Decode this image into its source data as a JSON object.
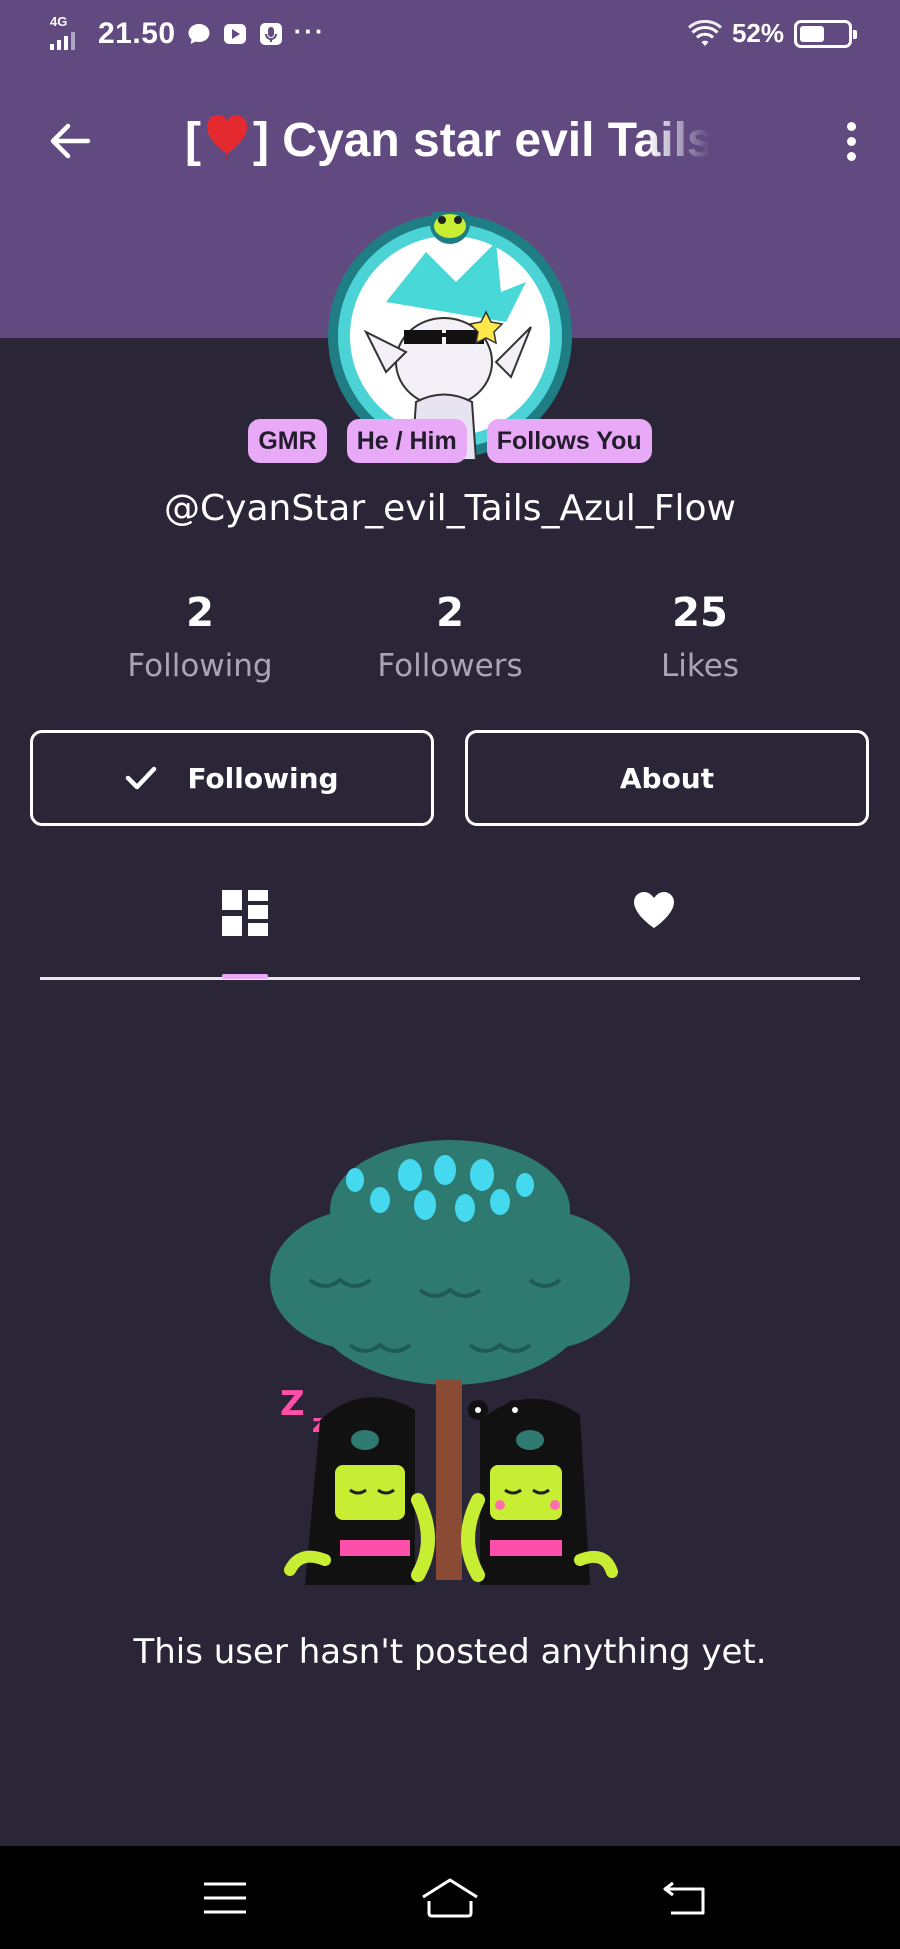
{
  "status_bar": {
    "network": "4G",
    "time": "21.50",
    "more": "···",
    "battery": "52%",
    "battery_level": 0.52
  },
  "appbar": {
    "title_prefix": "[",
    "title_suffix": "] Cyan star evil Tails",
    "back_icon": "arrow-left-icon",
    "more_icon": "more-vertical-icon"
  },
  "profile": {
    "badges": [
      "GMR",
      "He / Him",
      "Follows You"
    ],
    "username": "@CyanStar_evil_Tails_Azul_Flow",
    "stats": [
      {
        "value": "2",
        "label": "Following"
      },
      {
        "value": "2",
        "label": "Followers"
      },
      {
        "value": "25",
        "label": "Likes"
      }
    ],
    "following_button": "Following",
    "about_button": "About"
  },
  "tabs": [
    {
      "name": "posts",
      "icon": "grid-icon",
      "active": true
    },
    {
      "name": "likes",
      "icon": "heart-icon",
      "active": false
    }
  ],
  "empty_state": {
    "message": "This user hasn't posted anything yet."
  },
  "colors": {
    "header": "#614a80",
    "background": "#2a2637",
    "badge": "#e8a9f7",
    "accent": "#e8a9f7",
    "navbar": "#000000"
  }
}
